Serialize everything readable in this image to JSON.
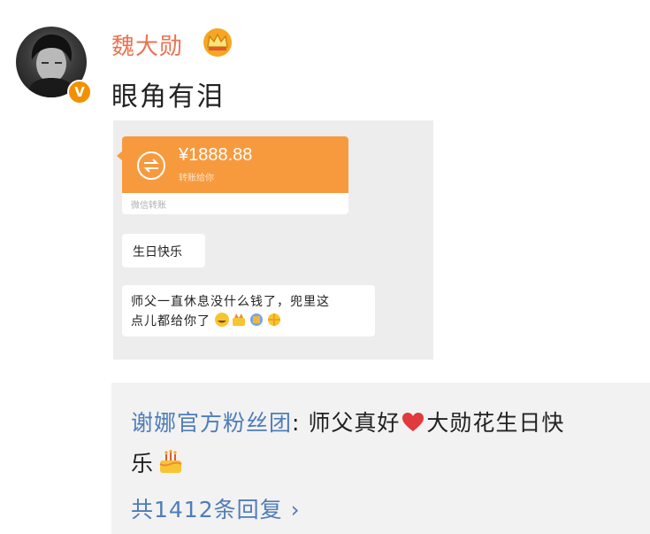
{
  "post": {
    "username": "魏大勋",
    "text": "眼角有泪",
    "verified_badge": "V"
  },
  "screenshot": {
    "transfer": {
      "amount": "¥1888.88",
      "status": "转账给你",
      "footer": "微信转账"
    },
    "messages": [
      "生日快乐",
      "师父一直休息没什么钱了，兜里这",
      "点儿都给你了"
    ]
  },
  "comment": {
    "author": "谢娜官方粉丝团",
    "separator": ": ",
    "text_a": "师父真好",
    "text_b": "大勋花生日快",
    "text_c": "乐",
    "replies": "共1412条回复 ›"
  },
  "colors": {
    "username": "#eb7350",
    "link": "#4f7db8",
    "transfer": "#f79a3e",
    "badge": "#f29100"
  },
  "icons": [
    "crown-icon",
    "transfer-icon",
    "heart-icon",
    "cake-icon",
    "verified-icon"
  ]
}
